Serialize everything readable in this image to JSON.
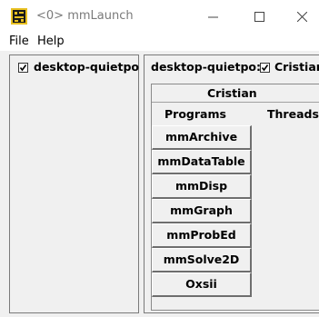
{
  "window": {
    "title": "<0> mmLaunch",
    "icon": "mmlaunch-app-icon",
    "controls": [
      "minimize-icon",
      "maximize-icon",
      "close-icon"
    ]
  },
  "menu": {
    "items": [
      "File",
      "Help"
    ]
  },
  "hosts_panel": {
    "hosts": [
      {
        "label": "desktop-quietpo",
        "checked": true
      }
    ]
  },
  "host_detail": {
    "host_label": "desktop-quietpo:",
    "user_checkbox": {
      "label": "Cristian",
      "checked": true
    },
    "user_name": "Cristian",
    "programs_header": "Programs",
    "threads_header": "Threads",
    "programs": [
      "mmArchive",
      "mmDataTable",
      "mmDisp",
      "mmGraph",
      "mmProbEd",
      "mmSolve2D",
      "Oxsii"
    ]
  }
}
